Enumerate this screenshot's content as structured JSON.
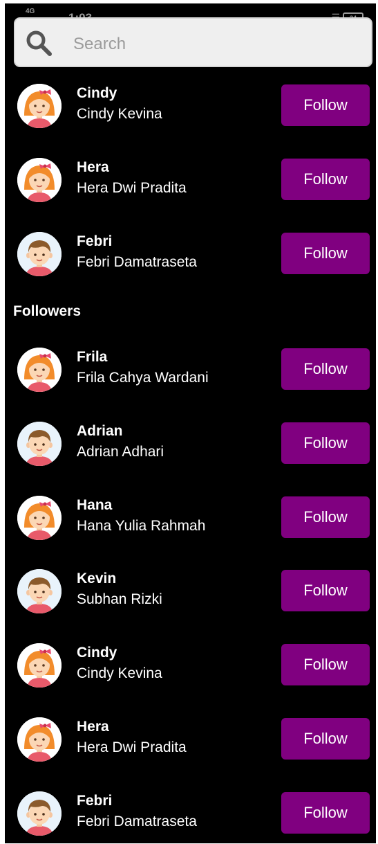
{
  "status_bar": {
    "signal": "4G",
    "time": "1:03",
    "battery": "34"
  },
  "search": {
    "placeholder": "Search"
  },
  "suggestions": [
    {
      "username": "Cindy",
      "full_name": "Cindy Kevina",
      "avatar": "girl-avatar-icon",
      "button": "Follow"
    },
    {
      "username": "Hera",
      "full_name": "Hera Dwi Pradita",
      "avatar": "girl-avatar-icon",
      "button": "Follow"
    },
    {
      "username": "Febri",
      "full_name": "Febri Damatraseta",
      "avatar": "boy-avatar-icon",
      "button": "Follow"
    }
  ],
  "followers": {
    "title": "Followers",
    "items": [
      {
        "username": "Frila",
        "full_name": "Frila Cahya Wardani",
        "avatar": "girl-avatar-icon",
        "button": "Follow"
      },
      {
        "username": "Adrian",
        "full_name": "Adrian Adhari",
        "avatar": "boy-avatar-icon",
        "button": "Follow"
      },
      {
        "username": "Hana",
        "full_name": "Hana Yulia Rahmah",
        "avatar": "girl-avatar-icon",
        "button": "Follow"
      },
      {
        "username": "Kevin",
        "full_name": "Subhan Rizki",
        "avatar": "boy-avatar-icon",
        "button": "Follow"
      },
      {
        "username": "Cindy",
        "full_name": "Cindy Kevina",
        "avatar": "girl-avatar-icon",
        "button": "Follow"
      },
      {
        "username": "Hera",
        "full_name": "Hera Dwi Pradita",
        "avatar": "girl-avatar-icon",
        "button": "Follow"
      },
      {
        "username": "Febri",
        "full_name": "Febri Damatraseta",
        "avatar": "boy-avatar-icon",
        "button": "Follow"
      }
    ]
  },
  "colors": {
    "background": "#000000",
    "button": "#800080",
    "button_text": "#ffffff",
    "search_bg": "#efefef"
  }
}
